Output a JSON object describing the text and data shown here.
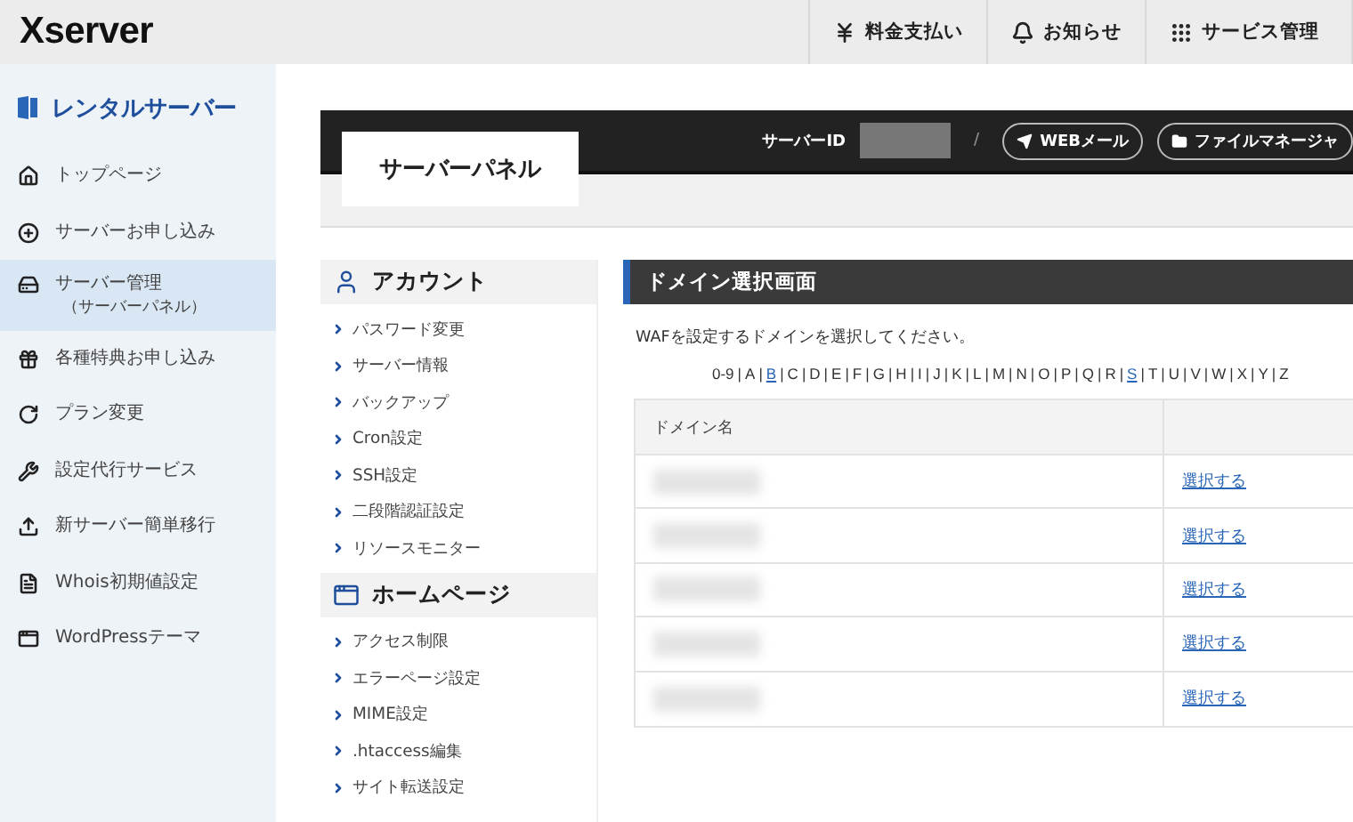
{
  "header": {
    "logo": "Xserver",
    "actions": [
      {
        "kind": "yen",
        "label": "料金支払い"
      },
      {
        "kind": "bell",
        "label": "お知らせ"
      },
      {
        "kind": "grid",
        "label": "サービス管理"
      }
    ]
  },
  "sidebar": {
    "title": "レンタルサーバー",
    "items": [
      {
        "kind": "home",
        "label": "トップページ",
        "selected": false
      },
      {
        "kind": "plus",
        "label": "サーバーお申し込み",
        "selected": false
      },
      {
        "kind": "server",
        "label": "サーバー管理",
        "sublabel": "（サーバーパネル）",
        "selected": true
      },
      {
        "kind": "gift",
        "label": "各種特典お申し込み",
        "selected": false
      },
      {
        "kind": "refresh",
        "label": "プラン変更",
        "selected": false
      },
      {
        "kind": "wrench",
        "label": "設定代行サービス",
        "selected": false
      },
      {
        "kind": "upload",
        "label": "新サーバー簡単移行",
        "selected": false
      },
      {
        "kind": "doc",
        "label": "Whois初期値設定",
        "selected": false
      },
      {
        "kind": "window",
        "label": "WordPressテーマ",
        "selected": false
      }
    ]
  },
  "panel_bar": {
    "tab": "サーバーパネル",
    "server_id_label": "サーバーID",
    "divider": "/",
    "buttons": [
      {
        "kind": "send",
        "label": "WEBメール"
      },
      {
        "kind": "folder",
        "label": "ファイルマネージャ"
      }
    ]
  },
  "menu": [
    {
      "kind": "user",
      "title": "アカウント",
      "items": [
        "パスワード変更",
        "サーバー情報",
        "バックアップ",
        "Cron設定",
        "SSH設定",
        "二段階認証設定",
        "リソースモニター"
      ]
    },
    {
      "kind": "window",
      "title": "ホームページ",
      "items": [
        "アクセス制限",
        "エラーページ設定",
        "MIME設定",
        ".htaccess編集",
        "サイト転送設定"
      ]
    }
  ],
  "content": {
    "title": "ドメイン選択画面",
    "description": "WAFを設定するドメインを選択してください。",
    "separator": "|",
    "index": [
      {
        "text": "0-9",
        "link": false
      },
      {
        "text": "A",
        "link": false
      },
      {
        "text": "B",
        "link": true
      },
      {
        "text": "C",
        "link": false
      },
      {
        "text": "D",
        "link": false
      },
      {
        "text": "E",
        "link": false
      },
      {
        "text": "F",
        "link": false
      },
      {
        "text": "G",
        "link": false
      },
      {
        "text": "H",
        "link": false
      },
      {
        "text": "I",
        "link": false
      },
      {
        "text": "J",
        "link": false
      },
      {
        "text": "K",
        "link": false
      },
      {
        "text": "L",
        "link": false
      },
      {
        "text": "M",
        "link": false
      },
      {
        "text": "N",
        "link": false
      },
      {
        "text": "O",
        "link": false
      },
      {
        "text": "P",
        "link": false
      },
      {
        "text": "Q",
        "link": false
      },
      {
        "text": "R",
        "link": false
      },
      {
        "text": "S",
        "link": true
      },
      {
        "text": "T",
        "link": false
      },
      {
        "text": "U",
        "link": false
      },
      {
        "text": "V",
        "link": false
      },
      {
        "text": "W",
        "link": false
      },
      {
        "text": "X",
        "link": false
      },
      {
        "text": "Y",
        "link": false
      },
      {
        "text": "Z",
        "link": false
      }
    ],
    "table": {
      "columns": [
        "ドメイン名"
      ],
      "rows": [
        {
          "action": "選択する"
        },
        {
          "action": "選択する"
        },
        {
          "action": "選択する"
        },
        {
          "action": "選択する"
        },
        {
          "action": "選択する"
        }
      ]
    }
  }
}
